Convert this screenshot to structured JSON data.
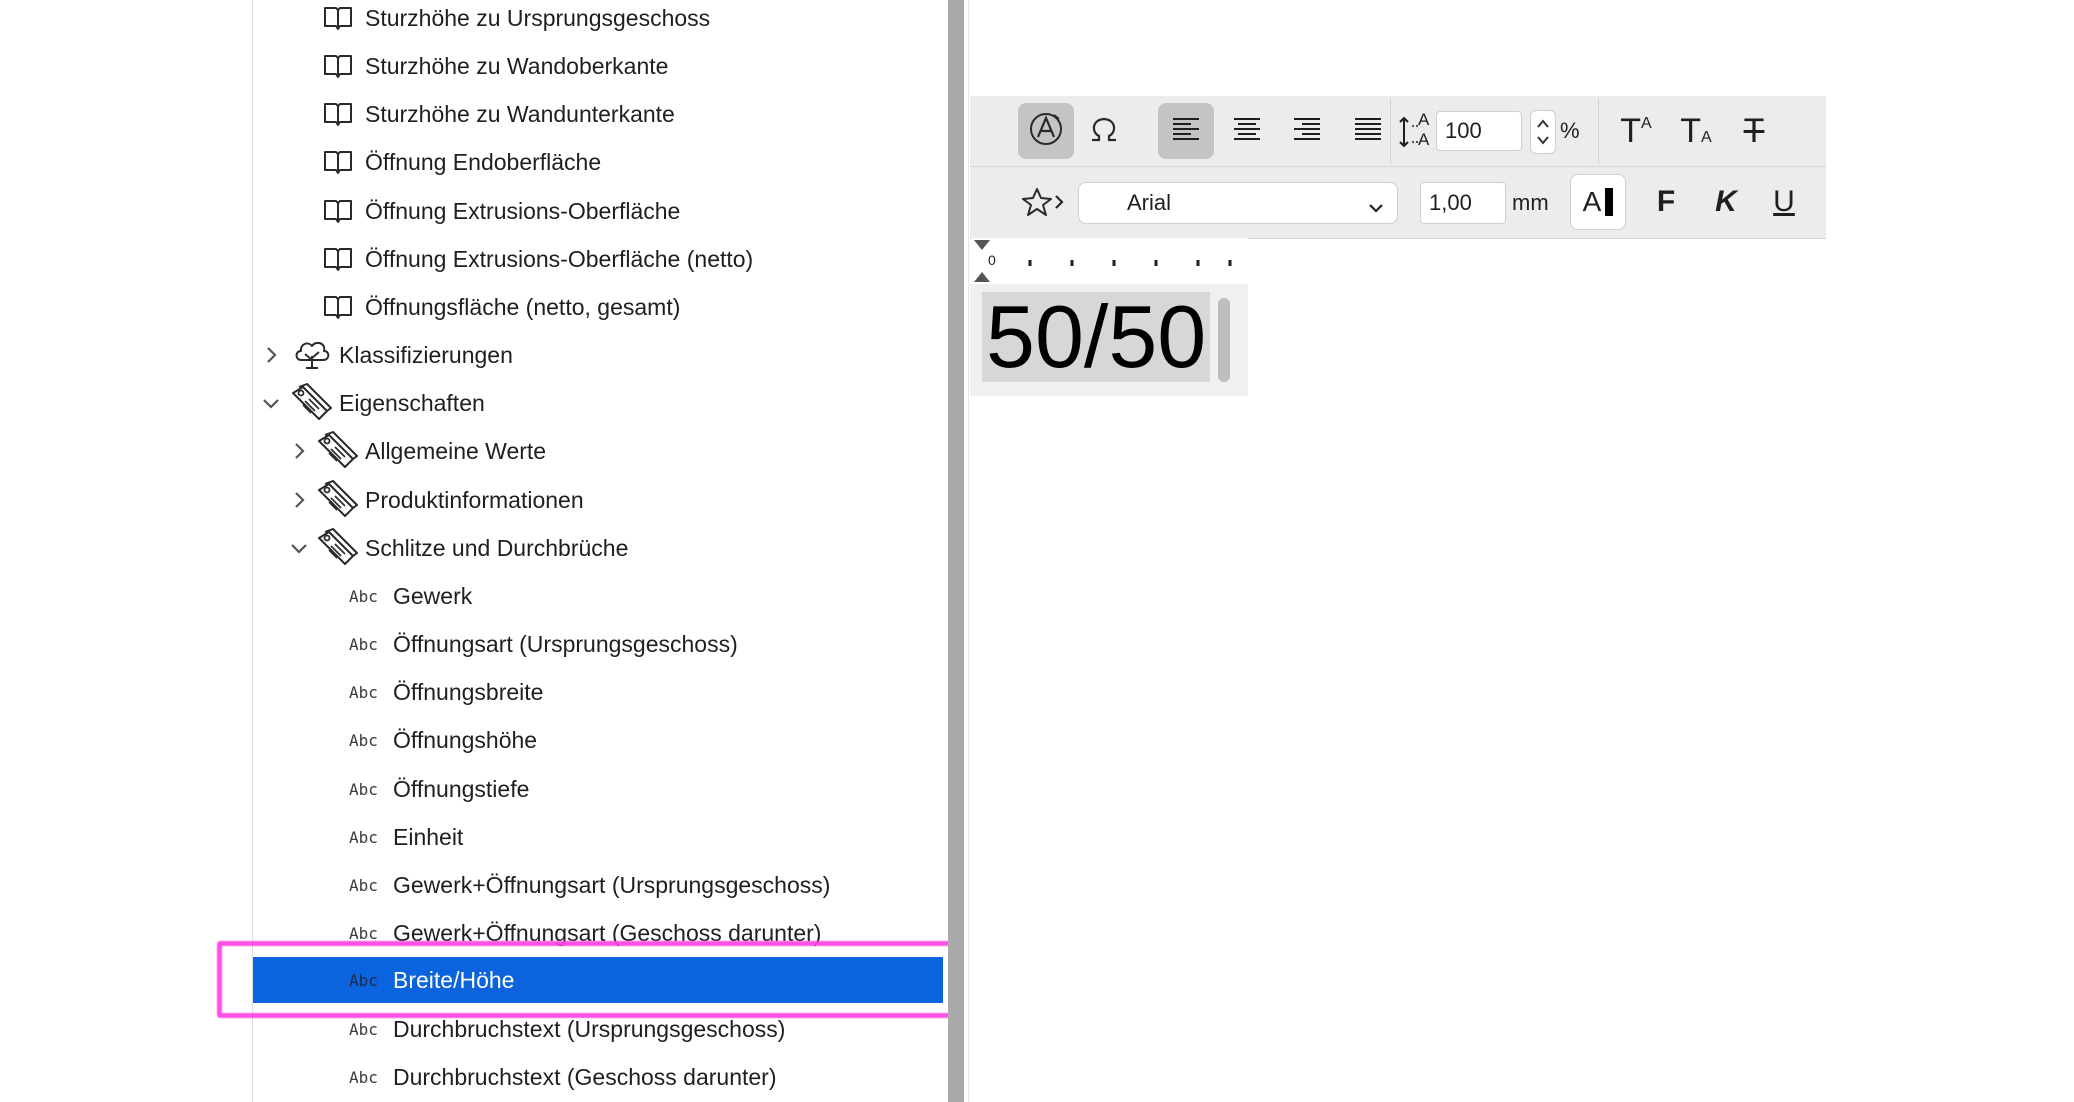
{
  "tree": {
    "items": [
      {
        "label": "Sturzhöhe zu Ursprungsgeschoss",
        "icon": "book-icon"
      },
      {
        "label": "Sturzhöhe zu Wandoberkante",
        "icon": "book-icon"
      },
      {
        "label": "Sturzhöhe zu Wandunterkante",
        "icon": "book-icon"
      },
      {
        "label": "Öffnung Endoberfläche",
        "icon": "book-icon"
      },
      {
        "label": "Öffnung Extrusions-Oberfläche",
        "icon": "book-icon"
      },
      {
        "label": "Öffnung Extrusions-Oberfläche (netto)",
        "icon": "book-icon"
      },
      {
        "label": "Öffnungsfläche (netto, gesamt)",
        "icon": "book-icon"
      },
      {
        "label": "Klassifizierungen",
        "icon": "tree-icon",
        "expanded": false
      },
      {
        "label": "Eigenschaften",
        "icon": "tags-icon",
        "expanded": true
      },
      {
        "label": "Allgemeine Werte",
        "icon": "tags-icon",
        "expanded": false
      },
      {
        "label": "Produktinformationen",
        "icon": "tags-icon",
        "expanded": false
      },
      {
        "label": "Schlitze und Durchbrüche",
        "icon": "tags-icon",
        "expanded": true
      },
      {
        "label": "Gewerk",
        "type": "Abc"
      },
      {
        "label": "Öffnungsart (Ursprungsgeschoss)",
        "type": "Abc"
      },
      {
        "label": "Öffnungsbreite",
        "type": "Abc"
      },
      {
        "label": "Öffnungshöhe",
        "type": "Abc"
      },
      {
        "label": "Öffnungstiefe",
        "type": "Abc"
      },
      {
        "label": "Einheit",
        "type": "Abc"
      },
      {
        "label": "Gewerk+Öffnungsart (Ursprungsgeschoss)",
        "type": "Abc"
      },
      {
        "label": "Gewerk+Öffnungsart (Geschoss darunter)",
        "type": "Abc"
      },
      {
        "label": "Breite/Höhe",
        "type": "Abc",
        "selected": true
      },
      {
        "label": "Durchbruchstext (Ursprungsgeschoss)",
        "type": "Abc"
      },
      {
        "label": "Durchbruchstext (Geschoss darunter)",
        "type": "Abc"
      }
    ]
  },
  "toolbar": {
    "line_spacing_value": "100",
    "percent_label": "%",
    "font_name": "Arial",
    "size_value": "1,00",
    "size_unit": "mm",
    "color_swatch_label": "A",
    "bold_label": "F",
    "italic_label": "K",
    "underline_label": "U",
    "superscript_label": "T",
    "superscript_small": "A",
    "subscript_label": "T",
    "subscript_small": "A",
    "line_spacing_glyph": "A",
    "strike_label": "T"
  },
  "ruler": {
    "zero_label": "0"
  },
  "editor": {
    "text": "50/50"
  },
  "colors": {
    "selection": "#0b64dd",
    "highlight": "#ff3fe0"
  }
}
